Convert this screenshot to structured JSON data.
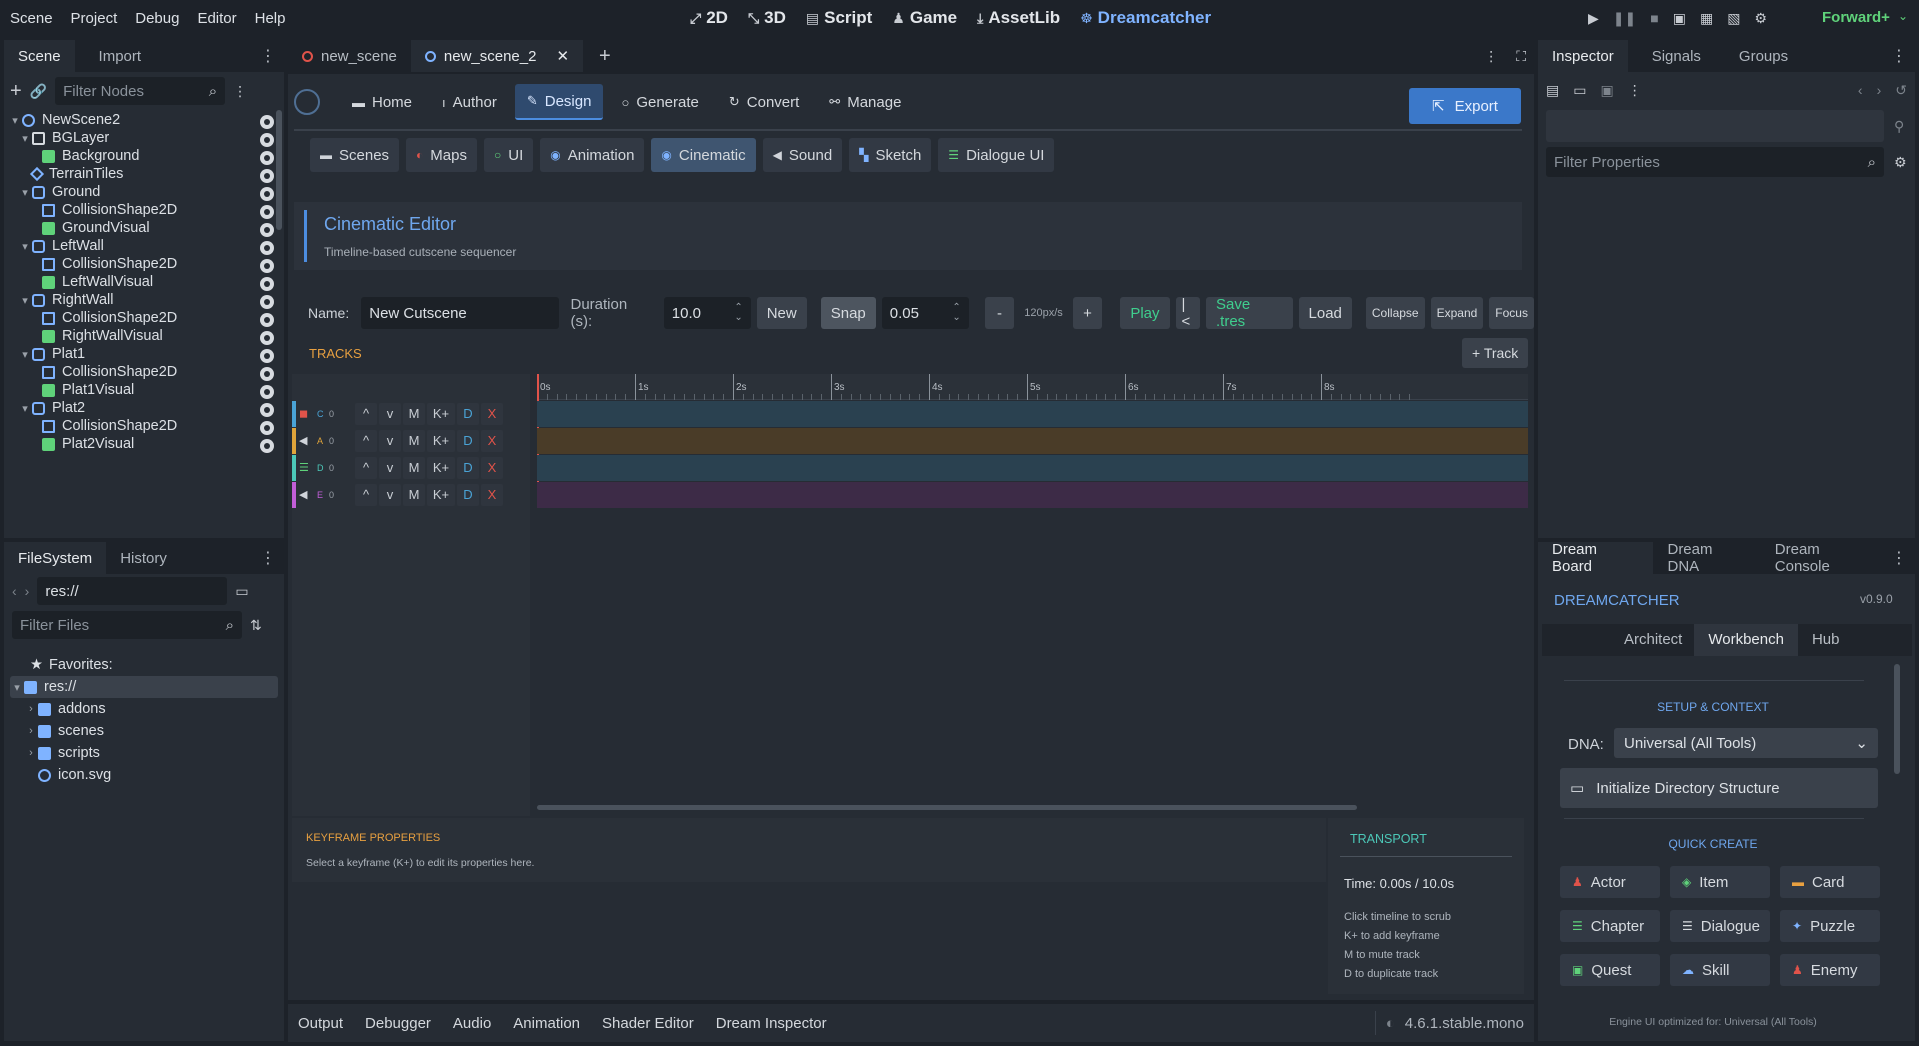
{
  "menubar": {
    "menus": [
      "Scene",
      "Project",
      "Debug",
      "Editor",
      "Help"
    ],
    "workspaces": [
      {
        "label": "2D",
        "icon": "2d-icon"
      },
      {
        "label": "3D",
        "icon": "3d-icon"
      },
      {
        "label": "Script",
        "icon": "script-icon"
      },
      {
        "label": "Game",
        "icon": "game-icon"
      },
      {
        "label": "AssetLib",
        "icon": "assetlib-icon"
      },
      {
        "label": "Dreamcatcher",
        "icon": "dreamcatcher-icon"
      }
    ],
    "renderer": "Forward+"
  },
  "scene_dock": {
    "tabs": [
      "Scene",
      "Import"
    ],
    "filter_placeholder": "Filter Nodes",
    "nodes": [
      {
        "label": "NewScene2",
        "depth": 0,
        "caret": "▾",
        "type": "node"
      },
      {
        "label": "BGLayer",
        "depth": 1,
        "caret": "▾",
        "type": "canvas"
      },
      {
        "label": "Background",
        "depth": 2,
        "caret": "",
        "type": "sprite"
      },
      {
        "label": "TerrainTiles",
        "depth": 1,
        "caret": "",
        "type": "tilemap"
      },
      {
        "label": "Ground",
        "depth": 1,
        "caret": "▾",
        "type": "body"
      },
      {
        "label": "CollisionShape2D",
        "depth": 2,
        "caret": "",
        "type": "shape"
      },
      {
        "label": "GroundVisual",
        "depth": 2,
        "caret": "",
        "type": "sprite"
      },
      {
        "label": "LeftWall",
        "depth": 1,
        "caret": "▾",
        "type": "body"
      },
      {
        "label": "CollisionShape2D",
        "depth": 2,
        "caret": "",
        "type": "shape"
      },
      {
        "label": "LeftWallVisual",
        "depth": 2,
        "caret": "",
        "type": "sprite"
      },
      {
        "label": "RightWall",
        "depth": 1,
        "caret": "▾",
        "type": "body"
      },
      {
        "label": "CollisionShape2D",
        "depth": 2,
        "caret": "",
        "type": "shape"
      },
      {
        "label": "RightWallVisual",
        "depth": 2,
        "caret": "",
        "type": "sprite"
      },
      {
        "label": "Plat1",
        "depth": 1,
        "caret": "▾",
        "type": "body"
      },
      {
        "label": "CollisionShape2D",
        "depth": 2,
        "caret": "",
        "type": "shape"
      },
      {
        "label": "Plat1Visual",
        "depth": 2,
        "caret": "",
        "type": "sprite"
      },
      {
        "label": "Plat2",
        "depth": 1,
        "caret": "▾",
        "type": "body"
      },
      {
        "label": "CollisionShape2D",
        "depth": 2,
        "caret": "",
        "type": "shape"
      },
      {
        "label": "Plat2Visual",
        "depth": 2,
        "caret": "",
        "type": "sprite"
      }
    ]
  },
  "filesystem": {
    "tabs": [
      "FileSystem",
      "History"
    ],
    "path": "res://",
    "filter_placeholder": "Filter Files",
    "favorites": "Favorites:",
    "root": "res://",
    "items": [
      {
        "label": "addons",
        "type": "folder"
      },
      {
        "label": "scenes",
        "type": "folder"
      },
      {
        "label": "scripts",
        "type": "folder"
      },
      {
        "label": "icon.svg",
        "type": "file"
      }
    ]
  },
  "scene_tabs": [
    "new_scene",
    "new_scene_2"
  ],
  "dreamcatcher": {
    "main_tabs": [
      {
        "label": "Home",
        "icon": "home-icon"
      },
      {
        "label": "Author",
        "icon": "author-icon"
      },
      {
        "label": "Design",
        "icon": "design-icon",
        "active": true
      },
      {
        "label": "Generate",
        "icon": "generate-icon"
      },
      {
        "label": "Convert",
        "icon": "convert-icon"
      },
      {
        "label": "Manage",
        "icon": "manage-icon"
      }
    ],
    "export_label": "Export",
    "sub_tabs": [
      {
        "label": "Scenes",
        "icon": "scenes-icon"
      },
      {
        "label": "Maps",
        "icon": "maps-icon"
      },
      {
        "label": "UI",
        "icon": "ui-icon"
      },
      {
        "label": "Animation",
        "icon": "animation-icon"
      },
      {
        "label": "Cinematic",
        "icon": "cinematic-icon",
        "active": true
      },
      {
        "label": "Sound",
        "icon": "sound-icon"
      },
      {
        "label": "Sketch",
        "icon": "sketch-icon"
      },
      {
        "label": "Dialogue UI",
        "icon": "dialogue-ui-icon"
      }
    ],
    "editor_title": "Cinematic Editor",
    "editor_subtitle": "Timeline-based cutscene sequencer",
    "toolbar": {
      "name_label": "Name:",
      "name_value": "New Cutscene",
      "duration_label": "Duration (s):",
      "duration_value": "10.0",
      "new_label": "New",
      "snap_label": "Snap",
      "snap_value": "0.05",
      "zoom_out": "-",
      "zoom_level": "120px/s",
      "zoom_in": "+",
      "play": "Play",
      "rewind": "|<",
      "save": "Save .tres",
      "load": "Load",
      "collapse": "Collapse",
      "expand": "Expand",
      "focus": "Focus"
    },
    "tracks_label": "TRACKS",
    "add_track_label": "+ Track",
    "ruler": [
      "0s",
      "1s",
      "2s",
      "3s",
      "4s",
      "5s",
      "6s",
      "7s",
      "8s"
    ],
    "tracks": [
      {
        "letter": "C",
        "count": "0",
        "color": "#4aa3d6",
        "lane": "#2a4150",
        "icon": "camera-icon",
        "icon_color": "#e0534a"
      },
      {
        "letter": "A",
        "count": "0",
        "color": "#e0a43a",
        "lane": "#4a3c28",
        "icon": "audio-icon",
        "icon_color": "#d0d4da"
      },
      {
        "letter": "D",
        "count": "0",
        "color": "#4cc8b8",
        "lane": "#2a4150",
        "icon": "dialogue-icon",
        "icon_color": "#5fd27a"
      },
      {
        "letter": "E",
        "count": "0",
        "color": "#c25ed8",
        "lane": "#3d2b47",
        "icon": "event-icon",
        "icon_color": "#d0d4da"
      }
    ],
    "track_buttons": {
      "up": "^",
      "down": "v",
      "mute": "M",
      "key": "K+",
      "dup": "D",
      "del": "X"
    },
    "keyframe_title": "KEYFRAME PROPERTIES",
    "keyframe_hint": "Select a keyframe (K+) to edit its properties here.",
    "transport_title": "TRANSPORT",
    "transport_time": "Time: 0.00s / 10.0s",
    "transport_hints": [
      "Click timeline to scrub",
      "K+ to add keyframe",
      "M to mute track",
      "D to duplicate track"
    ]
  },
  "bottom_panel": {
    "tabs": [
      "Output",
      "Debugger",
      "Audio",
      "Animation",
      "Shader Editor",
      "Dream Inspector"
    ],
    "version": "4.6.1.stable.mono"
  },
  "inspector": {
    "tabs": [
      "Inspector",
      "Signals",
      "Groups"
    ],
    "filter_placeholder": "Filter Properties"
  },
  "dream_board": {
    "tabs": [
      "Dream Board",
      "Dream DNA",
      "Dream Console"
    ],
    "title": "DREAMCATCHER",
    "version": "v0.9.0",
    "mode_tabs": [
      "Architect",
      "Workbench",
      "Hub"
    ],
    "setup_title": "SETUP & CONTEXT",
    "dna_label": "DNA:",
    "dna_value": "Universal (All Tools)",
    "init_label": "Initialize Directory Structure",
    "quick_create_title": "QUICK CREATE",
    "quick_create": [
      {
        "label": "Actor",
        "icon": "actor-icon",
        "color": "#e0534a"
      },
      {
        "label": "Item",
        "icon": "item-icon",
        "color": "#5fd27a"
      },
      {
        "label": "Card",
        "icon": "card-icon",
        "color": "#e8a040"
      },
      {
        "label": "Chapter",
        "icon": "chapter-icon",
        "color": "#5fd27a"
      },
      {
        "label": "Dialogue",
        "icon": "dialogue-icon",
        "color": "#d8dce0"
      },
      {
        "label": "Puzzle",
        "icon": "puzzle-icon",
        "color": "#7fb3ff"
      },
      {
        "label": "Quest",
        "icon": "quest-icon",
        "color": "#5fd27a"
      },
      {
        "label": "Skill",
        "icon": "skill-icon",
        "color": "#7fb3ff"
      },
      {
        "label": "Enemy",
        "icon": "enemy-icon",
        "color": "#e0534a"
      }
    ],
    "footer": "Engine UI optimized for: Universal (All Tools)"
  },
  "colors": {
    "accent": "#4c8de0",
    "play_green": "#3fcf8e",
    "orange_label": "#e8a040"
  }
}
